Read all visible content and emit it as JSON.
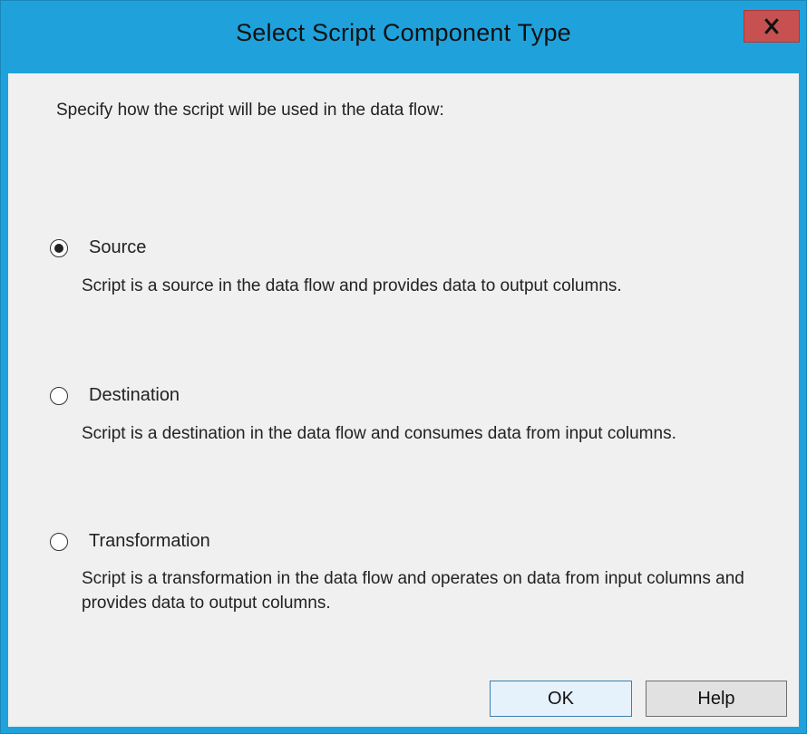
{
  "dialog": {
    "title": "Select Script Component Type",
    "close_label": "x",
    "instructions": "Specify how the script will be used in the data flow:"
  },
  "options": [
    {
      "label": "Source",
      "description": "Script is a source in the data flow and provides data to output columns.",
      "selected": true
    },
    {
      "label": "Destination",
      "description": "Script is a destination in the data flow and consumes data from input columns.",
      "selected": false
    },
    {
      "label": "Transformation",
      "description": "Script is a transformation in the data flow and operates on data from input columns and provides data to output columns.",
      "selected": false
    }
  ],
  "buttons": {
    "ok_label": "OK",
    "help_label": "Help"
  },
  "colors": {
    "window_border": "#1fa2dc",
    "close_button": "#c75050",
    "client_background": "#f0f0f0"
  }
}
